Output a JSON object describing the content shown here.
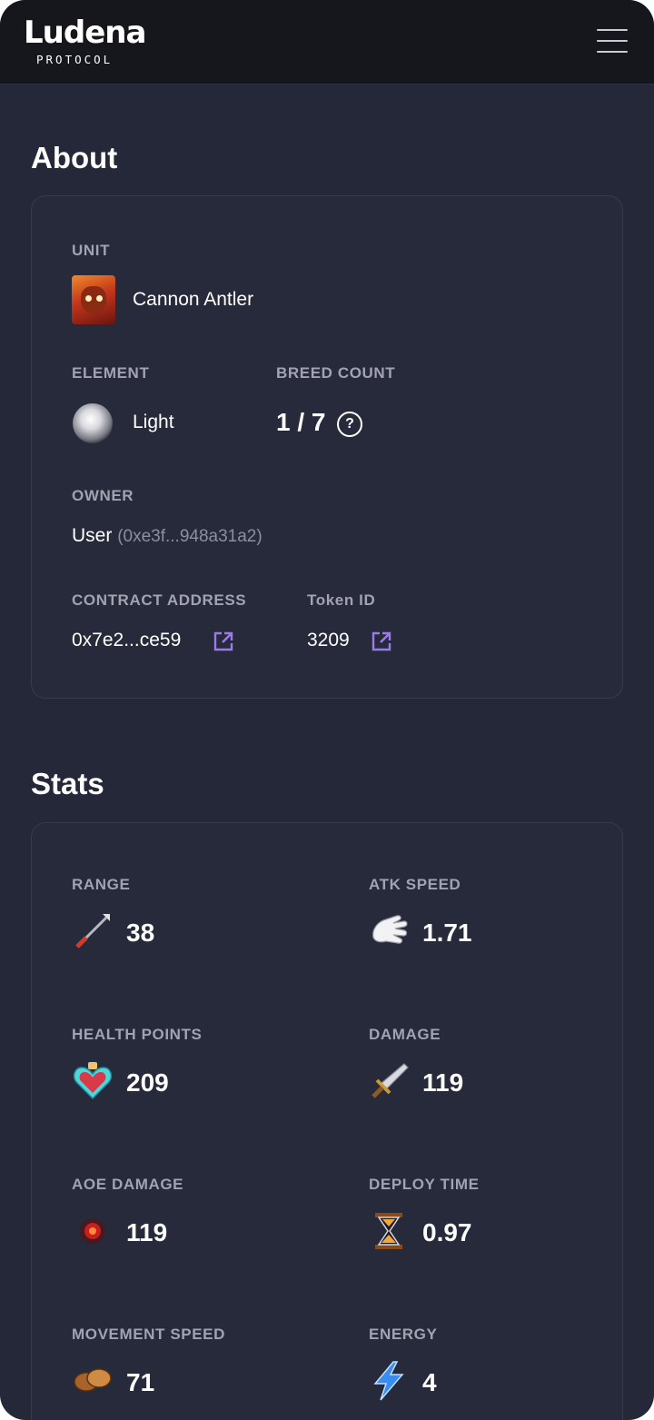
{
  "header": {
    "logo_text": "Ludena",
    "logo_subtext": "PROTOCOL",
    "menu_icon": "hamburger-menu-icon"
  },
  "about": {
    "title": "About",
    "unit_label": "UNIT",
    "unit_name": "Cannon Antler",
    "element_label": "ELEMENT",
    "element_value": "Light",
    "breed_label": "BREED COUNT",
    "breed_value": "1 / 7",
    "owner_label": "OWNER",
    "owner_name": "User",
    "owner_address": "(0xe3f...948a31a2)",
    "contract_label": "CONTRACT ADDRESS",
    "contract_value": "0x7e2...ce59",
    "token_label": "Token ID",
    "token_value": "3209",
    "accent_color": "#9b7bea"
  },
  "stats": {
    "title": "Stats",
    "items": [
      {
        "label": "RANGE",
        "value": "38",
        "icon": "arrow-icon"
      },
      {
        "label": "ATK SPEED",
        "value": "1.71",
        "icon": "glove-icon"
      },
      {
        "label": "HEALTH POINTS",
        "value": "209",
        "icon": "heart-potion-icon"
      },
      {
        "label": "DAMAGE",
        "value": "119",
        "icon": "sword-icon"
      },
      {
        "label": "AOE DAMAGE",
        "value": "119",
        "icon": "explosion-icon"
      },
      {
        "label": "DEPLOY TIME",
        "value": "0.97",
        "icon": "hourglass-icon"
      },
      {
        "label": "MOVEMENT SPEED",
        "value": "71",
        "icon": "boots-icon"
      },
      {
        "label": "ENERGY",
        "value": "4",
        "icon": "lightning-icon"
      }
    ]
  }
}
